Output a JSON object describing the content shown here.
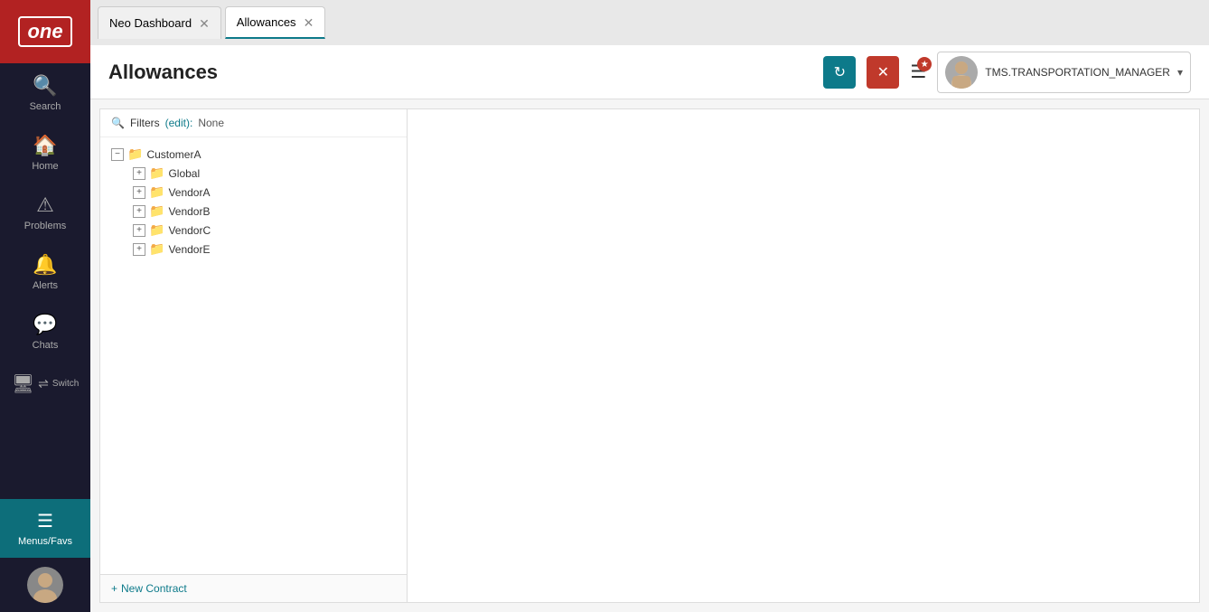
{
  "app": {
    "logo": "one",
    "logo_bg": "#b22222"
  },
  "sidebar": {
    "items": [
      {
        "id": "search",
        "label": "Search",
        "icon": "🔍"
      },
      {
        "id": "home",
        "label": "Home",
        "icon": "🏠"
      },
      {
        "id": "problems",
        "label": "Problems",
        "icon": "⚠"
      },
      {
        "id": "alerts",
        "label": "Alerts",
        "icon": "🔔"
      },
      {
        "id": "chats",
        "label": "Chats",
        "icon": "💬"
      },
      {
        "id": "switch",
        "label": "Switch",
        "icon": "⇌"
      }
    ],
    "bottom_menu": {
      "label": "Menus/Favs"
    }
  },
  "tabs": [
    {
      "id": "neo-dashboard",
      "label": "Neo Dashboard",
      "active": false
    },
    {
      "id": "allowances",
      "label": "Allowances",
      "active": true
    }
  ],
  "header": {
    "title": "Allowances",
    "refresh_label": "↻",
    "close_label": "✕",
    "menu_label": "☰",
    "notification_badge": "★",
    "user": {
      "name": "TMS.TRANSPORTATION_MANAGER",
      "dropdown_arrow": "▾"
    }
  },
  "filters": {
    "label": "Filters",
    "edit_label": "(edit):",
    "value": "None"
  },
  "tree": {
    "root": {
      "label": "CustomerA",
      "expanded": true,
      "children": [
        {
          "label": "Global",
          "expanded": false,
          "children": []
        },
        {
          "label": "VendorA",
          "expanded": false,
          "children": []
        },
        {
          "label": "VendorB",
          "expanded": false,
          "children": []
        },
        {
          "label": "VendorC",
          "expanded": false,
          "children": []
        },
        {
          "label": "VendorE",
          "expanded": false,
          "children": []
        }
      ]
    }
  },
  "footer": {
    "new_contract_label": "New Contract",
    "plus_icon": "+"
  }
}
